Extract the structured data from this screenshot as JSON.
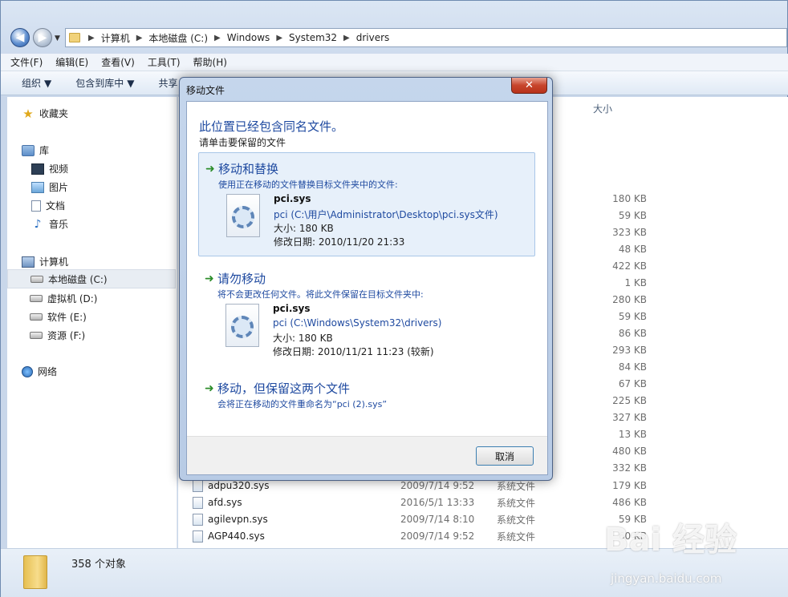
{
  "address": {
    "crumbs": [
      "计算机",
      "本地磁盘 (C:)",
      "Windows",
      "System32",
      "drivers"
    ]
  },
  "menu": [
    "文件(F)",
    "编辑(E)",
    "查看(V)",
    "工具(T)",
    "帮助(H)"
  ],
  "toolbar": {
    "organize": "组织",
    "include_library": "包含到库中",
    "share": "共享"
  },
  "nav": {
    "favorites": "收藏夹",
    "libraries": "库",
    "videos": "视频",
    "pictures": "图片",
    "documents": "文档",
    "music": "音乐",
    "computer": "计算机",
    "drive_c": "本地磁盘 (C:)",
    "drive_d": "虚拟机 (D:)",
    "drive_e": "软件 (E:)",
    "drive_f": "资源 (F:)",
    "network": "网络"
  },
  "filelist": {
    "size_header": "大小",
    "hidden_sizes": [
      "180 KB",
      "59 KB",
      "323 KB",
      "48 KB",
      "422 KB",
      "1 KB",
      "280 KB",
      "59 KB",
      "86 KB",
      "293 KB",
      "84 KB",
      "67 KB",
      "225 KB",
      "327 KB",
      "13 KB",
      "480 KB",
      "332 KB"
    ],
    "rows": [
      {
        "name": "adpu320.sys",
        "date": "2009/7/14 9:52",
        "type": "系统文件",
        "size": "179 KB"
      },
      {
        "name": "afd.sys",
        "date": "2016/5/1 13:33",
        "type": "系统文件",
        "size": "486 KB"
      },
      {
        "name": "agilevpn.sys",
        "date": "2009/7/14 8:10",
        "type": "系统文件",
        "size": "59 KB"
      },
      {
        "name": "AGP440.sys",
        "date": "2009/7/14 9:52",
        "type": "系统文件",
        "size": "60 KB"
      }
    ]
  },
  "status": {
    "count": "358 个对象"
  },
  "watermark": {
    "brand": "Bai 经验",
    "url": "jingyan.baidu.com"
  },
  "dialog": {
    "title": "移动文件",
    "close": "✕",
    "heading": "此位置已经包含同名文件。",
    "subheading": "请单击要保留的文件",
    "option1": {
      "title": "移动和替换",
      "desc": "使用正在移动的文件替换目标文件夹中的文件:",
      "file_name": "pci.sys",
      "file_path": "pci (C:\\用户\\Administrator\\Desktop\\pci.sys文件)",
      "file_size": "大小: 180 KB",
      "file_date": "修改日期: 2010/11/20 21:33"
    },
    "option2": {
      "title": "请勿移动",
      "desc": "将不会更改任何文件。将此文件保留在目标文件夹中:",
      "file_name": "pci.sys",
      "file_path": "pci (C:\\Windows\\System32\\drivers)",
      "file_size": "大小: 180 KB",
      "file_date": "修改日期: 2010/11/21 11:23 (较新)"
    },
    "option3": {
      "title": "移动，但保留这两个文件",
      "desc": "会将正在移动的文件重命名为“pci (2).sys”"
    },
    "cancel": "取消"
  }
}
